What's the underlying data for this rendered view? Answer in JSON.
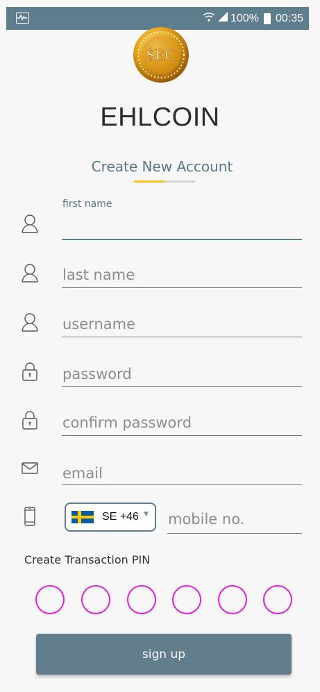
{
  "status_bar": {
    "battery": "100%",
    "time": "00:35"
  },
  "brand": {
    "name": "EHLCOIN",
    "logo_text": "$EC"
  },
  "page": {
    "subtitle": "Create New Account"
  },
  "form": {
    "first_name": {
      "label": "first name",
      "value": ""
    },
    "last_name": {
      "placeholder": "last name"
    },
    "username": {
      "placeholder": "username"
    },
    "password": {
      "placeholder": "password"
    },
    "confirm_password": {
      "placeholder": "confirm password"
    },
    "email": {
      "placeholder": "email"
    },
    "phone": {
      "country": "SE",
      "dial_code": "+46",
      "placeholder": "mobile no."
    }
  },
  "pin": {
    "title": "Create Transaction PIN",
    "digits": 6
  },
  "actions": {
    "signup_label": "sign up"
  },
  "colors": {
    "accent": "#5e7d8d",
    "pin_border": "#e11de1",
    "progress": "#f3c51c"
  }
}
